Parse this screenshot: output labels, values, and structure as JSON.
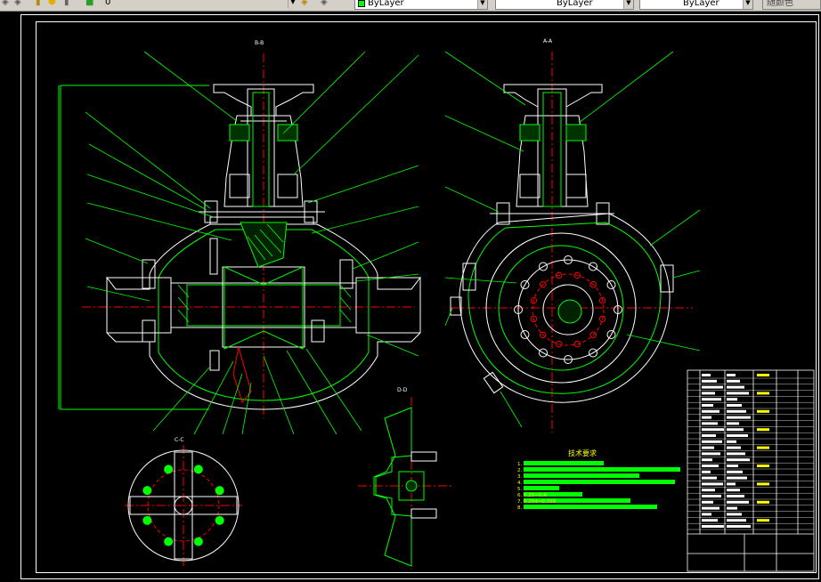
{
  "toolbar": {
    "layer_value": "0",
    "color_value": "ByLayer",
    "linetype_value": "ByLayer",
    "lineweight_value": "ByLayer",
    "plotstyle_value": "随颜色"
  },
  "drawing": {
    "section_bb": "B-B",
    "section_aa": "A-A",
    "section_cc": "C-C",
    "section_dd": "D-D",
    "tech_title": "技术要求",
    "tech_notes": [
      "1.",
      "2.",
      "3.",
      "4.",
      "5.",
      "6.                     0.25~0.4",
      "7.                              0.254~0.318"
    ],
    "tech_last": "8."
  },
  "colors": {
    "outline": "#ffffff",
    "leader": "#00ff00",
    "hatch": "#00ff00",
    "center": "#ff0000",
    "text": "#ffff00",
    "toolbar_bg": "#d4d0c8"
  }
}
